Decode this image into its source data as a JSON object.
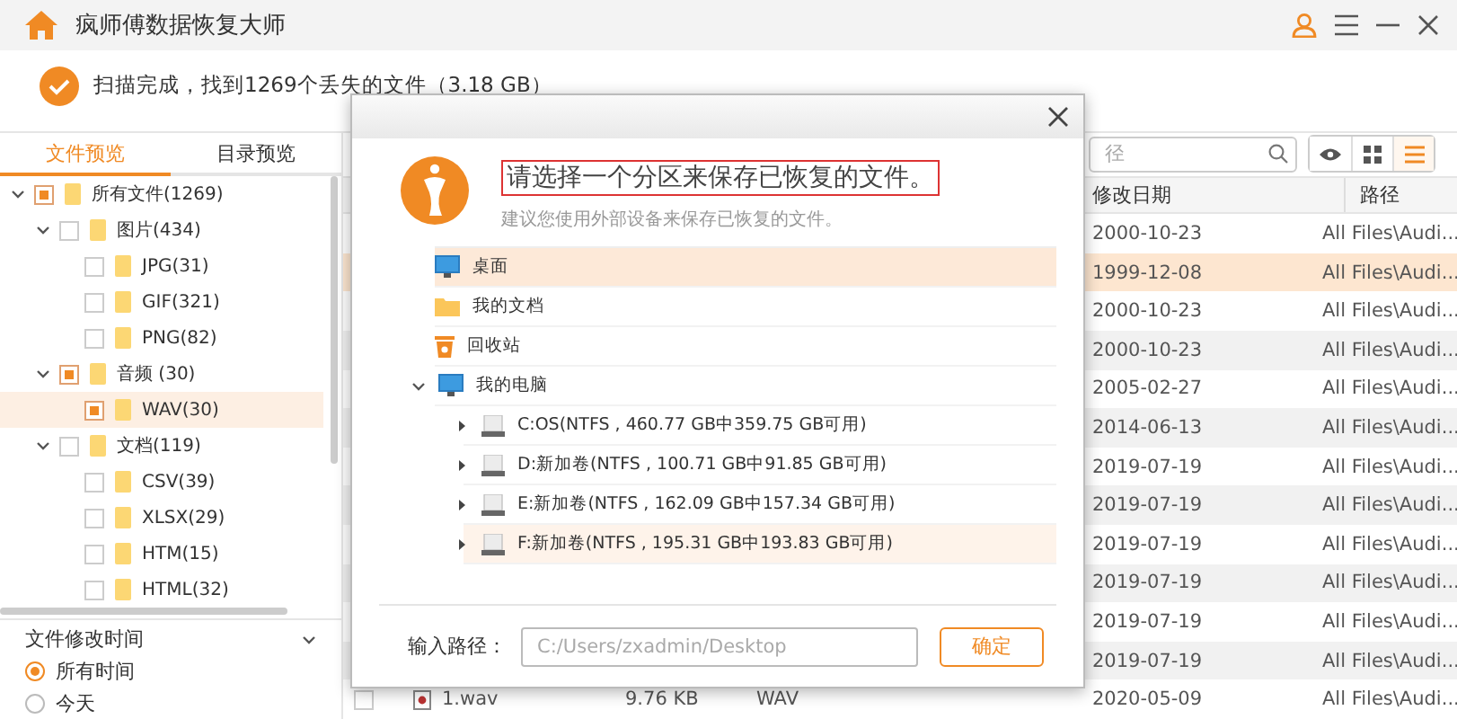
{
  "window": {
    "title": "疯师傅数据恢复大师"
  },
  "status": {
    "message": "扫描完成，找到1269个丢失的文件（3.18 GB）"
  },
  "left_tabs": [
    {
      "label": "文件预览",
      "selected": true
    },
    {
      "label": "目录预览",
      "selected": false
    }
  ],
  "tree": [
    {
      "label": "所有文件(1269)",
      "checked": true,
      "expanded": true,
      "selected": false,
      "children": [
        {
          "label": "图片(434)",
          "checked": false,
          "expanded": true,
          "selected": false,
          "children": [
            {
              "label": "JPG(31)",
              "checked": false,
              "selected": false
            },
            {
              "label": "GIF(321)",
              "checked": false,
              "selected": false
            },
            {
              "label": "PNG(82)",
              "checked": false,
              "selected": false
            }
          ]
        },
        {
          "label": "音频 (30)",
          "checked": true,
          "expanded": true,
          "selected": false,
          "children": [
            {
              "label": "WAV(30)",
              "checked": true,
              "selected": true
            }
          ]
        },
        {
          "label": "文档(119)",
          "checked": false,
          "expanded": true,
          "selected": false,
          "children": [
            {
              "label": "CSV(39)",
              "checked": false,
              "selected": false
            },
            {
              "label": "XLSX(29)",
              "checked": false,
              "selected": false
            },
            {
              "label": "HTM(15)",
              "checked": false,
              "selected": false
            },
            {
              "label": "HTML(32)",
              "checked": false,
              "selected": false
            }
          ]
        }
      ]
    }
  ],
  "filter": {
    "title": "文件修改时间",
    "options": [
      {
        "label": "所有时间",
        "selected": true
      },
      {
        "label": "今天",
        "selected": false
      }
    ]
  },
  "search": {
    "placeholder": "径"
  },
  "view_buttons": [
    {
      "kind": "preview",
      "selected": false
    },
    {
      "kind": "grid",
      "selected": false
    },
    {
      "kind": "list",
      "selected": true
    }
  ],
  "table": {
    "columns": [
      "修改日期",
      "路径"
    ],
    "rows": [
      {
        "date": "2000-10-23",
        "path": "All Files\\Audi...",
        "selected": false
      },
      {
        "date": "1999-12-08",
        "path": "All Files\\Audi...",
        "selected": true
      },
      {
        "date": "2000-10-23",
        "path": "All Files\\Audi...",
        "selected": false
      },
      {
        "date": "2000-10-23",
        "path": "All Files\\Audi...",
        "selected": false
      },
      {
        "date": "2005-02-27",
        "path": "All Files\\Audi...",
        "selected": false
      },
      {
        "date": "2014-06-13",
        "path": "All Files\\Audi...",
        "selected": false
      },
      {
        "date": "2019-07-19",
        "path": "All Files\\Audi...",
        "selected": false
      },
      {
        "date": "2019-07-19",
        "path": "All Files\\Audi...",
        "selected": false
      },
      {
        "date": "2019-07-19",
        "path": "All Files\\Audi...",
        "selected": false
      },
      {
        "date": "2019-07-19",
        "path": "All Files\\Audi...",
        "selected": false
      },
      {
        "date": "2019-07-19",
        "path": "All Files\\Audi...",
        "selected": false
      },
      {
        "date": "2019-07-19",
        "path": "All Files\\Audi...",
        "selected": false
      },
      {
        "checked": false,
        "name": "1.wav",
        "size": "9.76 KB",
        "type": "WAV",
        "date": "2020-05-09",
        "path": "All Files\\Audi...",
        "selected": false
      }
    ]
  },
  "dialog": {
    "title": "请选择一个分区来保存已恢复的文件。",
    "subtitle": "建议您使用外部设备来保存已恢复的文件。",
    "locations": [
      {
        "kind": "desktop",
        "label": "桌面",
        "selected": true,
        "hovered": false
      },
      {
        "kind": "folder",
        "label": "我的文档",
        "selected": false,
        "hovered": false
      },
      {
        "kind": "recycle",
        "label": "回收站",
        "selected": false,
        "hovered": false
      },
      {
        "kind": "computer",
        "label": "我的电脑",
        "selected": false,
        "hovered": false,
        "expanded": true,
        "children": [
          {
            "kind": "drive",
            "label": "C:OS(NTFS , 460.77 GB中359.75 GB可用)",
            "selected": false,
            "hovered": false,
            "expanded": false
          },
          {
            "kind": "drive",
            "label": "D:新加卷(NTFS , 100.71 GB中91.85 GB可用)",
            "selected": false,
            "hovered": false,
            "expanded": false
          },
          {
            "kind": "drive",
            "label": "E:新加卷(NTFS , 162.09 GB中157.34 GB可用)",
            "selected": false,
            "hovered": false,
            "expanded": false
          },
          {
            "kind": "drive",
            "label": "F:新加卷(NTFS , 195.31 GB中193.83 GB可用)",
            "selected": false,
            "hovered": true,
            "expanded": false
          }
        ]
      }
    ],
    "path_label": "输入路径：",
    "path_placeholder": "C:/Users/zxadmin/Desktop",
    "confirm": "确定"
  }
}
